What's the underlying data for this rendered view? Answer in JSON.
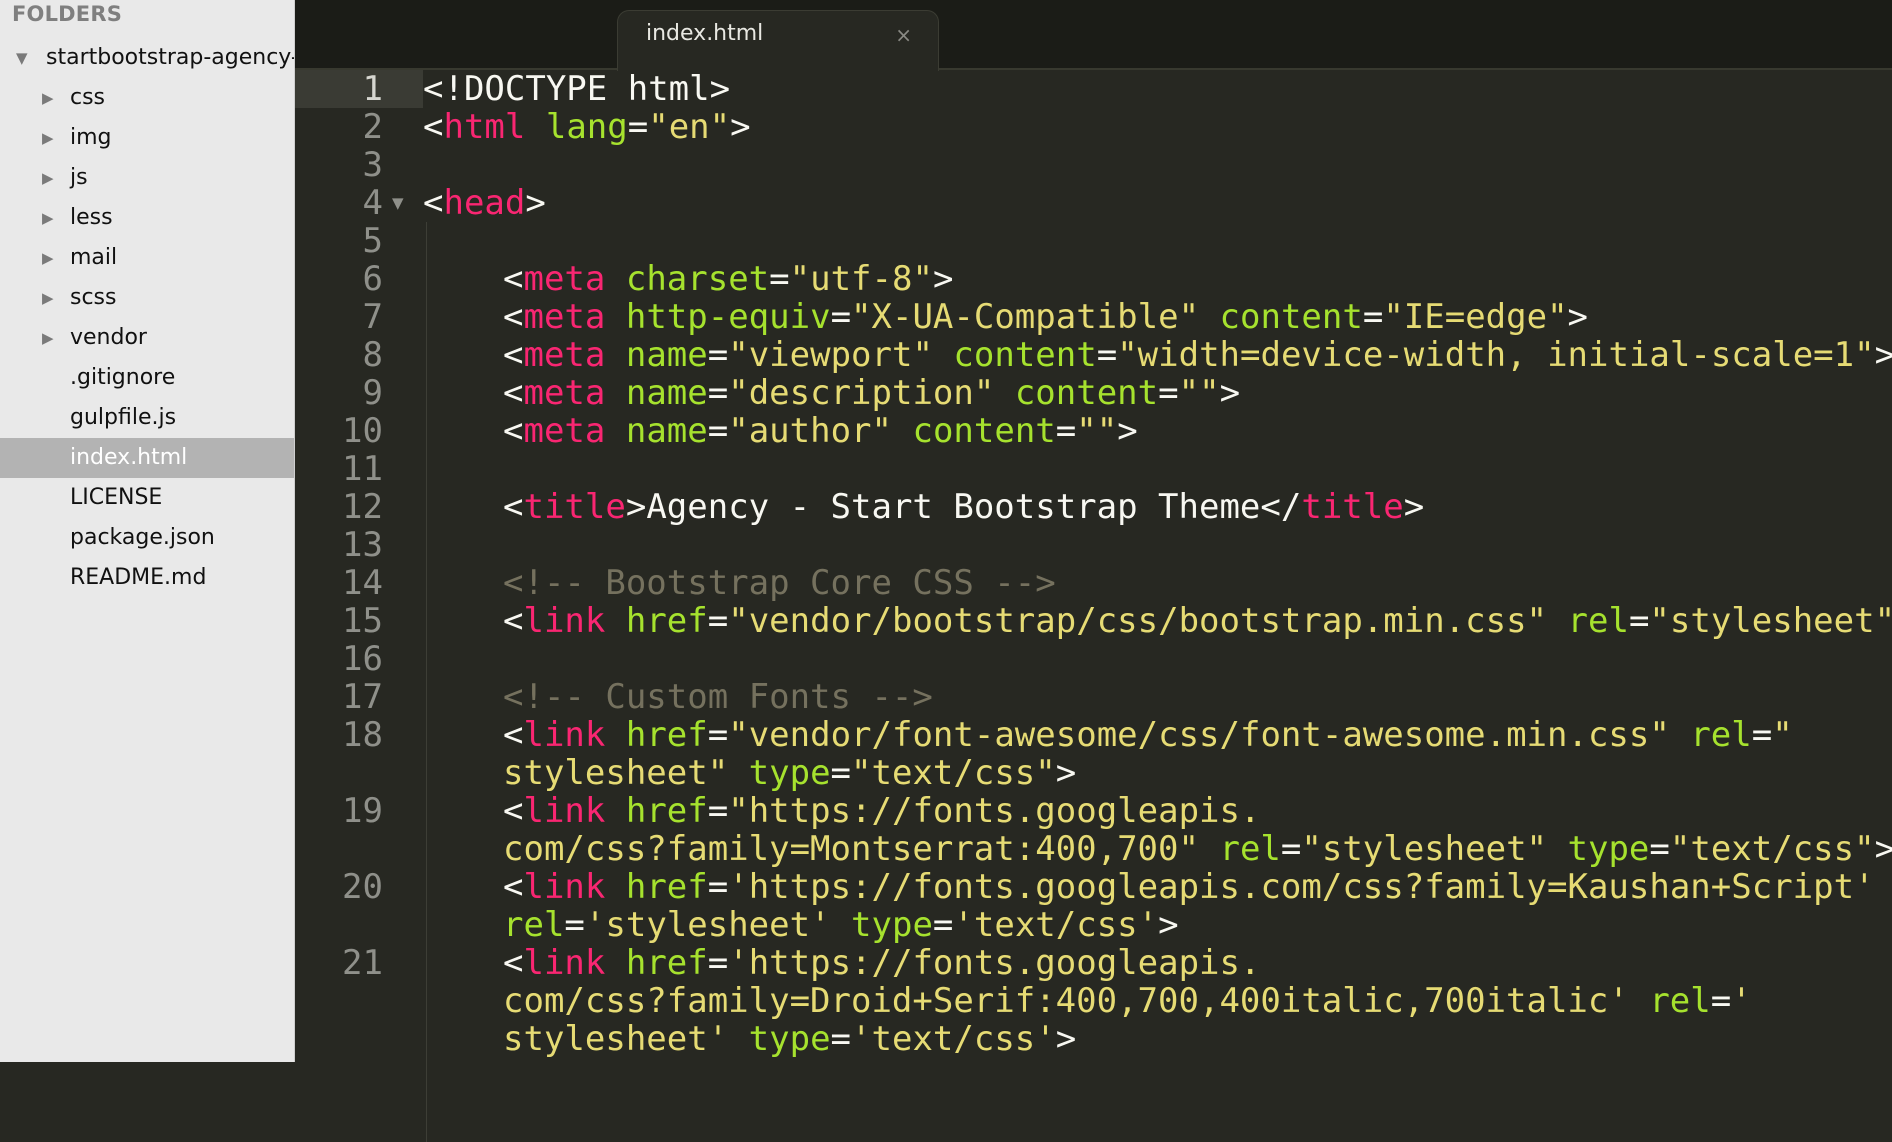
{
  "sidebar": {
    "header": "FOLDERS",
    "root": "startbootstrap-agency-",
    "items": [
      {
        "label": "css",
        "type": "folder"
      },
      {
        "label": "img",
        "type": "folder"
      },
      {
        "label": "js",
        "type": "folder"
      },
      {
        "label": "less",
        "type": "folder"
      },
      {
        "label": "mail",
        "type": "folder"
      },
      {
        "label": "scss",
        "type": "folder"
      },
      {
        "label": "vendor",
        "type": "folder"
      },
      {
        "label": ".gitignore",
        "type": "file"
      },
      {
        "label": "gulpfile.js",
        "type": "file"
      },
      {
        "label": "index.html",
        "type": "file",
        "selected": true
      },
      {
        "label": "LICENSE",
        "type": "file"
      },
      {
        "label": "package.json",
        "type": "file"
      },
      {
        "label": "README.md",
        "type": "file"
      }
    ]
  },
  "tab": {
    "title": "index.html",
    "close": "×"
  },
  "icons": {
    "folder_expanded": "▼",
    "folder_collapsed": "▶",
    "fold_marker": "▼"
  },
  "colors": {
    "editor_bg": "#272822",
    "plain": "#f8f8f2",
    "tag": "#f92672",
    "attribute": "#a6e22e",
    "string": "#e6db74",
    "comment": "#75715e",
    "sidebar_bg": "#e9e9e9",
    "selected_row": "#b3b3b3"
  },
  "editor": {
    "lines": [
      {
        "n": "1",
        "indent": 0,
        "tokens": [
          [
            "p",
            "<!DOCTYPE html>"
          ]
        ]
      },
      {
        "n": "2",
        "indent": 0,
        "tokens": [
          [
            "p",
            "<"
          ],
          [
            "tag",
            "html"
          ],
          [
            "p",
            " "
          ],
          [
            "attr",
            "lang"
          ],
          [
            "p",
            "="
          ],
          [
            "str",
            "\"en\""
          ],
          [
            "p",
            ">"
          ]
        ]
      },
      {
        "n": "3",
        "indent": 0,
        "tokens": []
      },
      {
        "n": "4",
        "indent": 0,
        "fold": true,
        "tokens": [
          [
            "p",
            "<"
          ],
          [
            "tag",
            "head"
          ],
          [
            "p",
            ">"
          ]
        ]
      },
      {
        "n": "5",
        "indent": 0,
        "tokens": []
      },
      {
        "n": "6",
        "indent": 4,
        "tokens": [
          [
            "p",
            "<"
          ],
          [
            "tag",
            "meta"
          ],
          [
            "p",
            " "
          ],
          [
            "attr",
            "charset"
          ],
          [
            "p",
            "="
          ],
          [
            "str",
            "\"utf-8\""
          ],
          [
            "p",
            ">"
          ]
        ]
      },
      {
        "n": "7",
        "indent": 4,
        "tokens": [
          [
            "p",
            "<"
          ],
          [
            "tag",
            "meta"
          ],
          [
            "p",
            " "
          ],
          [
            "attr",
            "http-equiv"
          ],
          [
            "p",
            "="
          ],
          [
            "str",
            "\"X-UA-Compatible\""
          ],
          [
            "p",
            " "
          ],
          [
            "attr",
            "content"
          ],
          [
            "p",
            "="
          ],
          [
            "str",
            "\"IE=edge\""
          ],
          [
            "p",
            ">"
          ]
        ]
      },
      {
        "n": "8",
        "indent": 4,
        "tokens": [
          [
            "p",
            "<"
          ],
          [
            "tag",
            "meta"
          ],
          [
            "p",
            " "
          ],
          [
            "attr",
            "name"
          ],
          [
            "p",
            "="
          ],
          [
            "str",
            "\"viewport\""
          ],
          [
            "p",
            " "
          ],
          [
            "attr",
            "content"
          ],
          [
            "p",
            "="
          ],
          [
            "str",
            "\"width=device-width, initial-scale=1\""
          ],
          [
            "p",
            ">"
          ]
        ]
      },
      {
        "n": "9",
        "indent": 4,
        "tokens": [
          [
            "p",
            "<"
          ],
          [
            "tag",
            "meta"
          ],
          [
            "p",
            " "
          ],
          [
            "attr",
            "name"
          ],
          [
            "p",
            "="
          ],
          [
            "str",
            "\"description\""
          ],
          [
            "p",
            " "
          ],
          [
            "attr",
            "content"
          ],
          [
            "p",
            "="
          ],
          [
            "str",
            "\"\""
          ],
          [
            "p",
            ">"
          ]
        ]
      },
      {
        "n": "10",
        "indent": 4,
        "tokens": [
          [
            "p",
            "<"
          ],
          [
            "tag",
            "meta"
          ],
          [
            "p",
            " "
          ],
          [
            "attr",
            "name"
          ],
          [
            "p",
            "="
          ],
          [
            "str",
            "\"author\""
          ],
          [
            "p",
            " "
          ],
          [
            "attr",
            "content"
          ],
          [
            "p",
            "="
          ],
          [
            "str",
            "\"\""
          ],
          [
            "p",
            ">"
          ]
        ]
      },
      {
        "n": "11",
        "indent": 4,
        "tokens": []
      },
      {
        "n": "12",
        "indent": 4,
        "tokens": [
          [
            "p",
            "<"
          ],
          [
            "tag",
            "title"
          ],
          [
            "p",
            ">Agency - Start Bootstrap Theme</"
          ],
          [
            "tag",
            "title"
          ],
          [
            "p",
            ">"
          ]
        ]
      },
      {
        "n": "13",
        "indent": 4,
        "tokens": []
      },
      {
        "n": "14",
        "indent": 4,
        "tokens": [
          [
            "com",
            "<!-- Bootstrap Core CSS -->"
          ]
        ]
      },
      {
        "n": "15",
        "indent": 4,
        "tokens": [
          [
            "p",
            "<"
          ],
          [
            "tag",
            "link"
          ],
          [
            "p",
            " "
          ],
          [
            "attr",
            "href"
          ],
          [
            "p",
            "="
          ],
          [
            "str",
            "\"vendor/bootstrap/css/bootstrap.min.css\""
          ],
          [
            "p",
            " "
          ],
          [
            "attr",
            "rel"
          ],
          [
            "p",
            "="
          ],
          [
            "str",
            "\"stylesheet\""
          ],
          [
            "p",
            ">"
          ]
        ]
      },
      {
        "n": "16",
        "indent": 4,
        "tokens": []
      },
      {
        "n": "17",
        "indent": 4,
        "tokens": [
          [
            "com",
            "<!-- Custom Fonts -->"
          ]
        ]
      },
      {
        "n": "18",
        "indent": 4,
        "tokens": [
          [
            "p",
            "<"
          ],
          [
            "tag",
            "link"
          ],
          [
            "p",
            " "
          ],
          [
            "attr",
            "href"
          ],
          [
            "p",
            "="
          ],
          [
            "str",
            "\"vendor/font-awesome/css/font-awesome.min.css\""
          ],
          [
            "p",
            " "
          ],
          [
            "attr",
            "rel"
          ],
          [
            "p",
            "="
          ],
          [
            "str",
            "\""
          ]
        ]
      },
      {
        "n": "",
        "indent": 4,
        "tokens": [
          [
            "str",
            "stylesheet\""
          ],
          [
            "p",
            " "
          ],
          [
            "attr",
            "type"
          ],
          [
            "p",
            "="
          ],
          [
            "str",
            "\"text/css\""
          ],
          [
            "p",
            ">"
          ]
        ]
      },
      {
        "n": "19",
        "indent": 4,
        "tokens": [
          [
            "p",
            "<"
          ],
          [
            "tag",
            "link"
          ],
          [
            "p",
            " "
          ],
          [
            "attr",
            "href"
          ],
          [
            "p",
            "="
          ],
          [
            "str",
            "\"https://fonts.googleapis."
          ]
        ]
      },
      {
        "n": "",
        "indent": 4,
        "tokens": [
          [
            "str",
            "com/css?family=Montserrat:400,700\""
          ],
          [
            "p",
            " "
          ],
          [
            "attr",
            "rel"
          ],
          [
            "p",
            "="
          ],
          [
            "str",
            "\"stylesheet\""
          ],
          [
            "p",
            " "
          ],
          [
            "attr",
            "type"
          ],
          [
            "p",
            "="
          ],
          [
            "str",
            "\"text/css\""
          ],
          [
            "p",
            ">"
          ]
        ]
      },
      {
        "n": "20",
        "indent": 4,
        "tokens": [
          [
            "p",
            "<"
          ],
          [
            "tag",
            "link"
          ],
          [
            "p",
            " "
          ],
          [
            "attr",
            "href"
          ],
          [
            "p",
            "="
          ],
          [
            "str",
            "'https://fonts.googleapis.com/css?family=Kaushan+Script'"
          ]
        ]
      },
      {
        "n": "",
        "indent": 4,
        "tokens": [
          [
            "attr",
            "rel"
          ],
          [
            "p",
            "="
          ],
          [
            "str",
            "'stylesheet'"
          ],
          [
            "p",
            " "
          ],
          [
            "attr",
            "type"
          ],
          [
            "p",
            "="
          ],
          [
            "str",
            "'text/css'"
          ],
          [
            "p",
            ">"
          ]
        ]
      },
      {
        "n": "21",
        "indent": 4,
        "tokens": [
          [
            "p",
            "<"
          ],
          [
            "tag",
            "link"
          ],
          [
            "p",
            " "
          ],
          [
            "attr",
            "href"
          ],
          [
            "p",
            "="
          ],
          [
            "str",
            "'https://fonts.googleapis."
          ]
        ]
      },
      {
        "n": "",
        "indent": 4,
        "tokens": [
          [
            "str",
            "com/css?family=Droid+Serif:400,700,400italic,700italic'"
          ],
          [
            "p",
            " "
          ],
          [
            "attr",
            "rel"
          ],
          [
            "p",
            "="
          ],
          [
            "str",
            "'"
          ]
        ]
      },
      {
        "n": "",
        "indent": 4,
        "tokens": [
          [
            "str",
            "stylesheet'"
          ],
          [
            "p",
            " "
          ],
          [
            "attr",
            "type"
          ],
          [
            "p",
            "="
          ],
          [
            "str",
            "'text/css'"
          ],
          [
            "p",
            ">"
          ]
        ]
      }
    ]
  }
}
